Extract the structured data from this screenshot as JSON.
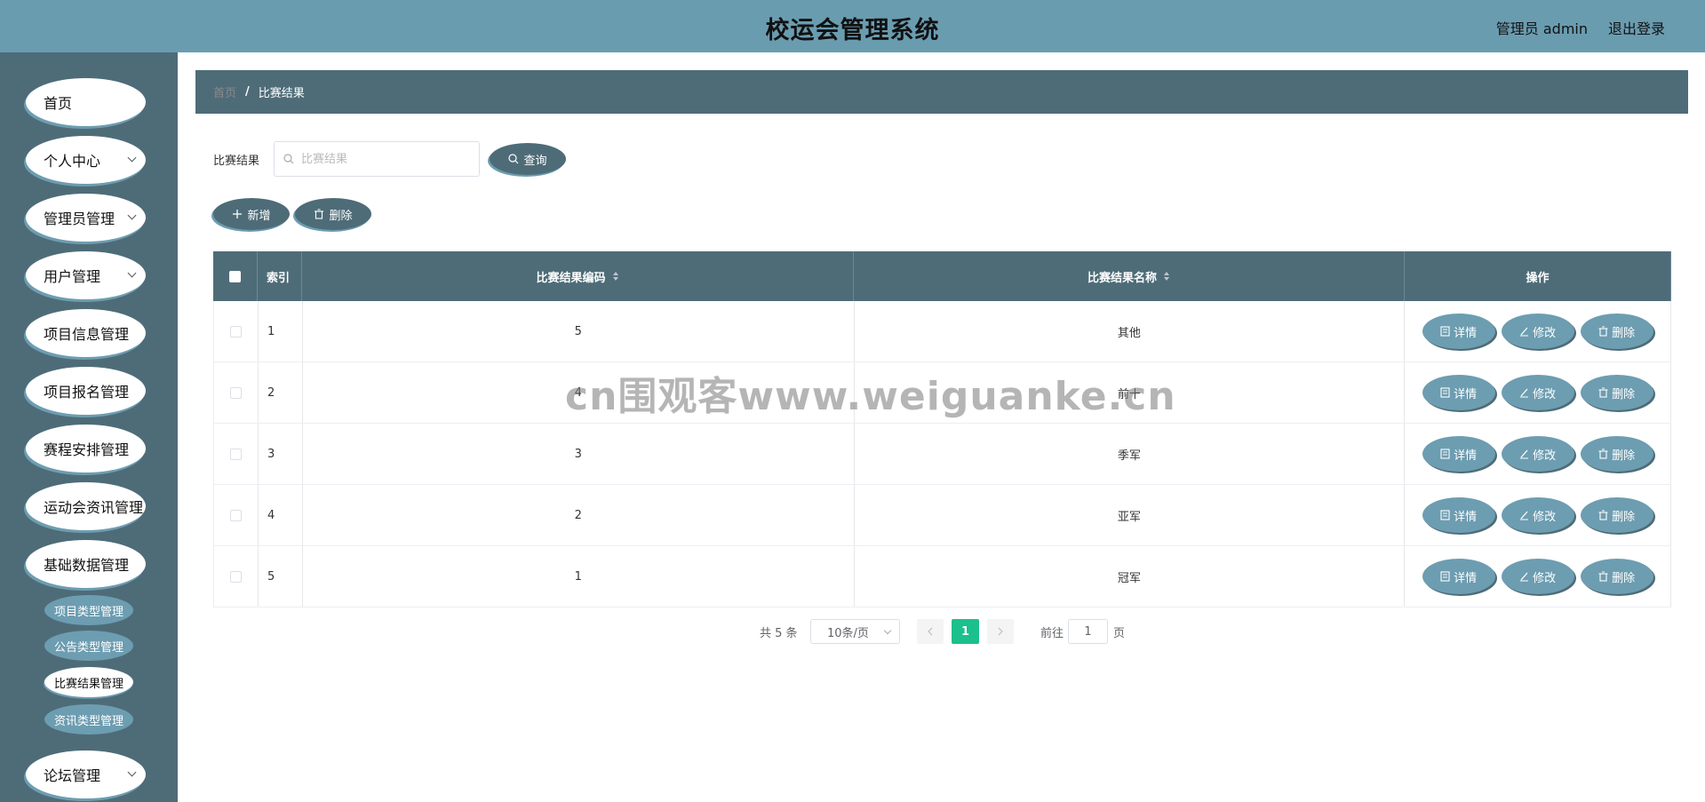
{
  "header": {
    "title": "校运会管理系统",
    "admin_label": "管理员 admin",
    "logout_label": "退出登录"
  },
  "sidebar": {
    "items": [
      {
        "label": "首页",
        "has_children": false
      },
      {
        "label": "个人中心",
        "has_children": true
      },
      {
        "label": "管理员管理",
        "has_children": true
      },
      {
        "label": "用户管理",
        "has_children": true
      },
      {
        "label": "项目信息管理",
        "has_children": true
      },
      {
        "label": "项目报名管理",
        "has_children": true
      },
      {
        "label": "赛程安排管理",
        "has_children": true
      },
      {
        "label": "运动会资讯管理",
        "has_children": true
      },
      {
        "label": "基础数据管理",
        "has_children": true
      },
      {
        "label": "论坛管理",
        "has_children": true
      }
    ],
    "subitems": [
      {
        "label": "项目类型管理",
        "active": false
      },
      {
        "label": "公告类型管理",
        "active": false
      },
      {
        "label": "比赛结果管理",
        "active": true
      },
      {
        "label": "资讯类型管理",
        "active": false
      }
    ]
  },
  "breadcrumb": {
    "home": "首页",
    "separator": "/",
    "current": "比赛结果"
  },
  "search": {
    "label": "比赛结果",
    "placeholder": "比赛结果",
    "value": "",
    "query_button": "查询"
  },
  "actions": {
    "add_label": "新增",
    "delete_label": "删除"
  },
  "table": {
    "columns": {
      "index": "索引",
      "code": "比赛结果编码",
      "name": "比赛结果名称",
      "ops": "操作"
    },
    "rows": [
      {
        "index": "1",
        "code": "5",
        "name": "其他"
      },
      {
        "index": "2",
        "code": "4",
        "name": "前十"
      },
      {
        "index": "3",
        "code": "3",
        "name": "季军"
      },
      {
        "index": "4",
        "code": "2",
        "name": "亚军"
      },
      {
        "index": "5",
        "code": "1",
        "name": "冠军"
      }
    ],
    "op_labels": {
      "detail": "详情",
      "edit": "修改",
      "delete": "删除"
    }
  },
  "pagination": {
    "total_label": "共 5 条",
    "page_size": "10条/页",
    "current_page": "1",
    "goto_label": "前往",
    "goto_value": "1",
    "page_suffix": "页"
  },
  "watermark": "cn围观客www.weiguanke.cn",
  "colors": {
    "header_bg": "#6a9cb0",
    "sidebar_bg": "#4e6c78",
    "accent_light": "#6d9db1",
    "active_page": "#1bc08c"
  }
}
